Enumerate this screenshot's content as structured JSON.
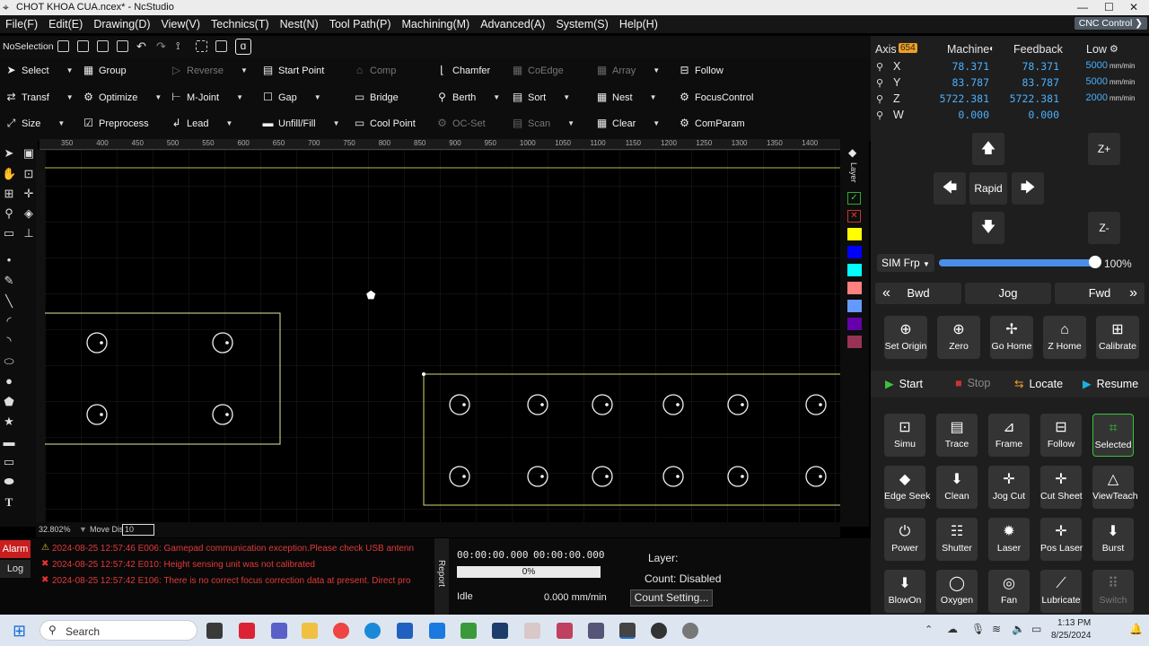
{
  "window": {
    "title": "CHOT KHOA CUA.ncex* - NcStudio"
  },
  "menu": [
    "File(F)",
    "Edit(E)",
    "Drawing(D)",
    "View(V)",
    "Technics(T)",
    "Nest(N)",
    "Tool Path(P)",
    "Machining(M)",
    "Advanced(A)",
    "System(S)",
    "Help(H)"
  ],
  "cnc_control_label": "CNC Control",
  "toolbar": {
    "selection": "NoSelection"
  },
  "ribbon": {
    "col1": [
      "Select",
      "Transf",
      "Size"
    ],
    "col2": [
      "Group",
      "Optimize",
      "Preprocess"
    ],
    "col3": [
      "Reverse",
      "M-Joint",
      "Lead"
    ],
    "col4": [
      "Start Point",
      "Gap",
      "Unfill/Fill"
    ],
    "col5": [
      "Comp",
      "Bridge",
      "Cool Point"
    ],
    "col6": [
      "Chamfer",
      "Berth",
      "OC-Set"
    ],
    "col7": [
      "CoEdge",
      "Sort",
      "Scan"
    ],
    "col8": [
      "Array",
      "Nest",
      "Clear"
    ],
    "col9": [
      "Follow",
      "FocusControl",
      "ComParam"
    ]
  },
  "ruler_ticks": [
    "350",
    "400",
    "450",
    "500",
    "550",
    "600",
    "650",
    "700",
    "750",
    "800",
    "850",
    "900",
    "950",
    "1000",
    "1050",
    "1100",
    "1150",
    "1200",
    "1250",
    "1300",
    "1350",
    "1400"
  ],
  "layer_label": "Layer",
  "layer_colors": [
    "#ffff00",
    "#0000ff",
    "#00ffff",
    "#ff8080",
    "#6699ff",
    "#6600aa",
    "#993355"
  ],
  "status": {
    "zoom": "32.802%",
    "move_label": "Move Dis",
    "move_value": "10"
  },
  "alarm": {
    "tabs": [
      "Alarm",
      "Log"
    ],
    "lines": [
      {
        "time": "2024-08-25 12:57:46",
        "text": "E006: Gamepad communication exception.Please check USB antenn"
      },
      {
        "time": "2024-08-25 12:57:42",
        "text": "E010: Height sensing unit was not calibrated"
      },
      {
        "time": "2024-08-25 12:57:42",
        "text": "E106: There is no correct focus correction data at present. Direct pro"
      }
    ],
    "report_label": "Report"
  },
  "timer": {
    "t1": "00:00:00.000",
    "t2": "00:00:00.000",
    "progress": "0%",
    "progress_value": 0,
    "state": "Idle",
    "speed": "0.000 mm/min",
    "layer_label": "Layer:",
    "count_label": "Count: Disabled",
    "count_button": "Count Setting..."
  },
  "axis": {
    "header": {
      "axis": "Axis",
      "badge": "654",
      "machine": "Machine",
      "feedback": "Feedback",
      "mode": "Low"
    },
    "rows": [
      {
        "name": "X",
        "machine": "78.371",
        "feedback": "78.371",
        "speed": "5000",
        "unit": "mm/min"
      },
      {
        "name": "Y",
        "machine": "83.787",
        "feedback": "83.787",
        "speed": "5000",
        "unit": "mm/min"
      },
      {
        "name": "Z",
        "machine": "5722.381",
        "feedback": "5722.381",
        "speed": "2000",
        "unit": "mm/min"
      },
      {
        "name": "W",
        "machine": "0.000",
        "feedback": "0.000",
        "speed": "",
        "unit": ""
      }
    ]
  },
  "jog": {
    "rapid": "Rapid",
    "zplus": "Z+",
    "zminus": "Z-"
  },
  "sim": {
    "select": "SIM Frp",
    "percent": "100%",
    "percent_value": 100
  },
  "motion": {
    "bwd": "Bwd",
    "jog": "Jog",
    "fwd": "Fwd"
  },
  "home_buttons": [
    "Set Origin",
    "Zero",
    "Go Home",
    "Z Home",
    "Calibrate"
  ],
  "run_buttons": [
    "Start",
    "Stop",
    "Locate",
    "Resume"
  ],
  "grid1": [
    "Simu",
    "Trace",
    "Frame",
    "Follow",
    "Selected"
  ],
  "grid2": [
    "Edge Seek",
    "Clean",
    "Jog Cut",
    "Cut Sheet",
    "ViewTeach"
  ],
  "grid3": [
    "Power",
    "Shutter",
    "Laser",
    "Pos Laser",
    "Burst"
  ],
  "grid4": [
    "BlowOn",
    "Oxygen",
    "Fan",
    "Lubricate",
    "Switch"
  ],
  "taskbar": {
    "search": "Search",
    "time": "1:13 PM",
    "date": "8/25/2024"
  }
}
